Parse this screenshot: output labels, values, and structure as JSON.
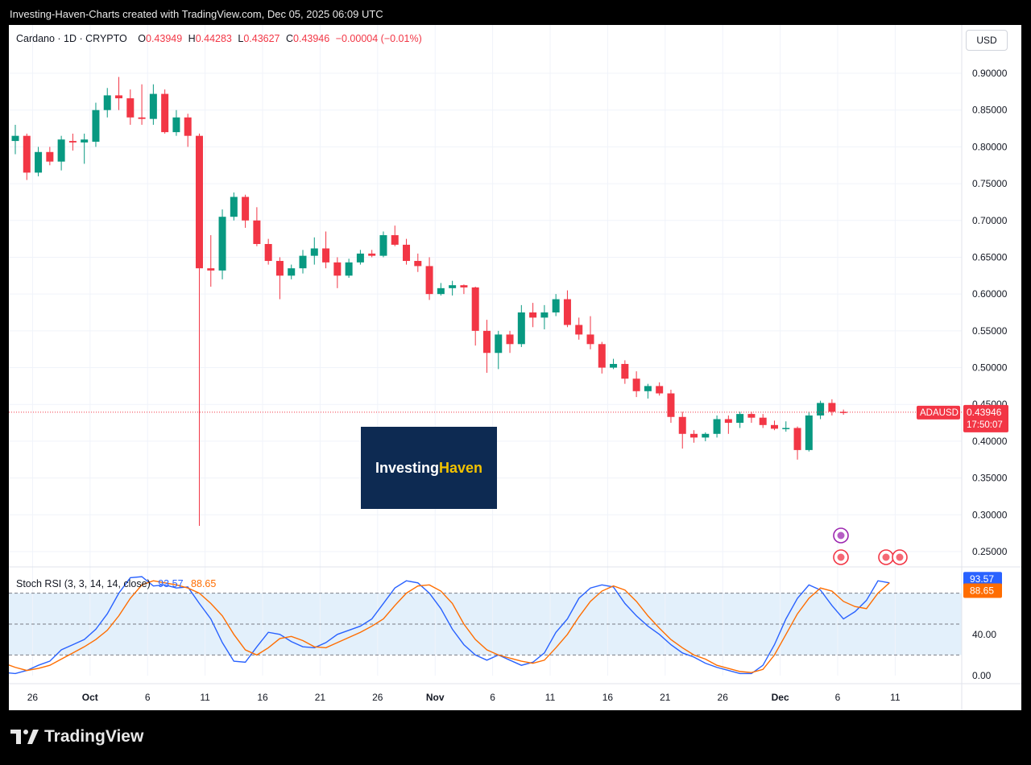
{
  "header": {
    "text": "Investing-Haven-Charts created with TradingView.com, Dec 05, 2025 06:09 UTC"
  },
  "legend": {
    "symbol": "Cardano · 1D · CRYPTO",
    "open_label": "O",
    "open": "0.43949",
    "high_label": "H",
    "high": "0.44283",
    "low_label": "L",
    "low": "0.43627",
    "close_label": "C",
    "close": "0.43946",
    "change": "−0.00004 (−0.01%)"
  },
  "currency_button": "USD",
  "price_tag": {
    "ticker": "ADAUSD",
    "price": "0.43946",
    "countdown": "17:50:07"
  },
  "logo": {
    "part1": "Investing",
    "part2": "Haven"
  },
  "brand": {
    "name": "TradingView"
  },
  "rsi_legend": {
    "label": "Stoch RSI (3, 3, 14, 14, close)",
    "k": "93.57",
    "d": "88.65"
  },
  "colors": {
    "up": "#089981",
    "down": "#f23645",
    "k_line": "#2962ff",
    "d_line": "#ff6d00",
    "logo_bg": "#0d2a52",
    "logo_accent": "#f2c200"
  },
  "chart_data": [
    {
      "type": "candlestick",
      "title": "Cardano · 1D · CRYPTO",
      "ylim": [
        0.22,
        0.95
      ],
      "y_ticks": [
        "0.90000",
        "0.85000",
        "0.80000",
        "0.75000",
        "0.70000",
        "0.65000",
        "0.60000",
        "0.55000",
        "0.50000",
        "0.45000",
        "0.40000",
        "0.35000",
        "0.30000",
        "0.25000"
      ],
      "x_ticks": [
        "26",
        "Oct",
        "6",
        "11",
        "16",
        "21",
        "26",
        "Nov",
        "6",
        "11",
        "16",
        "21",
        "26",
        "Dec",
        "6",
        "11"
      ],
      "last_price": 0.43946,
      "candles": [
        {
          "o": 0.808,
          "h": 0.83,
          "l": 0.79,
          "c": 0.815
        },
        {
          "o": 0.815,
          "h": 0.818,
          "l": 0.755,
          "c": 0.765
        },
        {
          "o": 0.765,
          "h": 0.8,
          "l": 0.76,
          "c": 0.793
        },
        {
          "o": 0.793,
          "h": 0.8,
          "l": 0.775,
          "c": 0.78
        },
        {
          "o": 0.78,
          "h": 0.815,
          "l": 0.768,
          "c": 0.81
        },
        {
          "o": 0.808,
          "h": 0.818,
          "l": 0.795,
          "c": 0.806
        },
        {
          "o": 0.806,
          "h": 0.818,
          "l": 0.777,
          "c": 0.81
        },
        {
          "o": 0.807,
          "h": 0.86,
          "l": 0.8,
          "c": 0.85
        },
        {
          "o": 0.85,
          "h": 0.88,
          "l": 0.84,
          "c": 0.87
        },
        {
          "o": 0.87,
          "h": 0.895,
          "l": 0.85,
          "c": 0.866
        },
        {
          "o": 0.866,
          "h": 0.878,
          "l": 0.83,
          "c": 0.84
        },
        {
          "o": 0.84,
          "h": 0.885,
          "l": 0.83,
          "c": 0.838
        },
        {
          "o": 0.838,
          "h": 0.885,
          "l": 0.83,
          "c": 0.872
        },
        {
          "o": 0.872,
          "h": 0.878,
          "l": 0.818,
          "c": 0.82
        },
        {
          "o": 0.82,
          "h": 0.85,
          "l": 0.815,
          "c": 0.84
        },
        {
          "o": 0.84,
          "h": 0.845,
          "l": 0.8,
          "c": 0.815
        },
        {
          "o": 0.815,
          "h": 0.818,
          "l": 0.285,
          "c": 0.635
        },
        {
          "o": 0.635,
          "h": 0.68,
          "l": 0.61,
          "c": 0.632
        },
        {
          "o": 0.632,
          "h": 0.715,
          "l": 0.62,
          "c": 0.705
        },
        {
          "o": 0.705,
          "h": 0.738,
          "l": 0.7,
          "c": 0.732
        },
        {
          "o": 0.732,
          "h": 0.735,
          "l": 0.69,
          "c": 0.7
        },
        {
          "o": 0.7,
          "h": 0.718,
          "l": 0.665,
          "c": 0.668
        },
        {
          "o": 0.668,
          "h": 0.675,
          "l": 0.64,
          "c": 0.645
        },
        {
          "o": 0.645,
          "h": 0.65,
          "l": 0.593,
          "c": 0.625
        },
        {
          "o": 0.625,
          "h": 0.64,
          "l": 0.62,
          "c": 0.635
        },
        {
          "o": 0.635,
          "h": 0.66,
          "l": 0.628,
          "c": 0.652
        },
        {
          "o": 0.652,
          "h": 0.677,
          "l": 0.64,
          "c": 0.662
        },
        {
          "o": 0.662,
          "h": 0.685,
          "l": 0.635,
          "c": 0.643
        },
        {
          "o": 0.643,
          "h": 0.65,
          "l": 0.608,
          "c": 0.625
        },
        {
          "o": 0.625,
          "h": 0.648,
          "l": 0.622,
          "c": 0.643
        },
        {
          "o": 0.643,
          "h": 0.66,
          "l": 0.64,
          "c": 0.655
        },
        {
          "o": 0.655,
          "h": 0.66,
          "l": 0.65,
          "c": 0.652
        },
        {
          "o": 0.652,
          "h": 0.685,
          "l": 0.65,
          "c": 0.68
        },
        {
          "o": 0.68,
          "h": 0.693,
          "l": 0.665,
          "c": 0.667
        },
        {
          "o": 0.667,
          "h": 0.675,
          "l": 0.64,
          "c": 0.645
        },
        {
          "o": 0.645,
          "h": 0.655,
          "l": 0.63,
          "c": 0.638
        },
        {
          "o": 0.638,
          "h": 0.65,
          "l": 0.592,
          "c": 0.6
        },
        {
          "o": 0.6,
          "h": 0.615,
          "l": 0.598,
          "c": 0.608
        },
        {
          "o": 0.608,
          "h": 0.618,
          "l": 0.598,
          "c": 0.612
        },
        {
          "o": 0.612,
          "h": 0.613,
          "l": 0.6,
          "c": 0.609
        },
        {
          "o": 0.609,
          "h": 0.61,
          "l": 0.53,
          "c": 0.55
        },
        {
          "o": 0.55,
          "h": 0.565,
          "l": 0.493,
          "c": 0.52
        },
        {
          "o": 0.52,
          "h": 0.55,
          "l": 0.498,
          "c": 0.545
        },
        {
          "o": 0.545,
          "h": 0.55,
          "l": 0.52,
          "c": 0.532
        },
        {
          "o": 0.532,
          "h": 0.585,
          "l": 0.528,
          "c": 0.575
        },
        {
          "o": 0.575,
          "h": 0.588,
          "l": 0.555,
          "c": 0.568
        },
        {
          "o": 0.568,
          "h": 0.585,
          "l": 0.552,
          "c": 0.575
        },
        {
          "o": 0.575,
          "h": 0.6,
          "l": 0.57,
          "c": 0.593
        },
        {
          "o": 0.593,
          "h": 0.605,
          "l": 0.555,
          "c": 0.558
        },
        {
          "o": 0.558,
          "h": 0.568,
          "l": 0.538,
          "c": 0.545
        },
        {
          "o": 0.545,
          "h": 0.57,
          "l": 0.525,
          "c": 0.532
        },
        {
          "o": 0.532,
          "h": 0.535,
          "l": 0.492,
          "c": 0.5
        },
        {
          "o": 0.5,
          "h": 0.512,
          "l": 0.498,
          "c": 0.505
        },
        {
          "o": 0.505,
          "h": 0.51,
          "l": 0.478,
          "c": 0.485
        },
        {
          "o": 0.485,
          "h": 0.495,
          "l": 0.46,
          "c": 0.468
        },
        {
          "o": 0.468,
          "h": 0.478,
          "l": 0.458,
          "c": 0.475
        },
        {
          "o": 0.475,
          "h": 0.48,
          "l": 0.462,
          "c": 0.465
        },
        {
          "o": 0.465,
          "h": 0.47,
          "l": 0.425,
          "c": 0.433
        },
        {
          "o": 0.433,
          "h": 0.44,
          "l": 0.39,
          "c": 0.41
        },
        {
          "o": 0.41,
          "h": 0.415,
          "l": 0.398,
          "c": 0.405
        },
        {
          "o": 0.405,
          "h": 0.412,
          "l": 0.4,
          "c": 0.41
        },
        {
          "o": 0.41,
          "h": 0.435,
          "l": 0.405,
          "c": 0.43
        },
        {
          "o": 0.43,
          "h": 0.435,
          "l": 0.41,
          "c": 0.425
        },
        {
          "o": 0.425,
          "h": 0.44,
          "l": 0.418,
          "c": 0.437
        },
        {
          "o": 0.437,
          "h": 0.44,
          "l": 0.425,
          "c": 0.432
        },
        {
          "o": 0.432,
          "h": 0.437,
          "l": 0.418,
          "c": 0.422
        },
        {
          "o": 0.422,
          "h": 0.428,
          "l": 0.415,
          "c": 0.417
        },
        {
          "o": 0.417,
          "h": 0.427,
          "l": 0.413,
          "c": 0.418
        },
        {
          "o": 0.418,
          "h": 0.42,
          "l": 0.375,
          "c": 0.388
        },
        {
          "o": 0.388,
          "h": 0.44,
          "l": 0.386,
          "c": 0.435
        },
        {
          "o": 0.435,
          "h": 0.455,
          "l": 0.43,
          "c": 0.452
        },
        {
          "o": 0.452,
          "h": 0.457,
          "l": 0.435,
          "c": 0.44
        },
        {
          "o": 0.44,
          "h": 0.443,
          "l": 0.436,
          "c": 0.4395
        }
      ]
    },
    {
      "type": "line",
      "title": "Stoch RSI (3, 3, 14, 14, close)",
      "ylim": [
        0,
        100
      ],
      "y_ticks": [
        "0.00",
        "40.00"
      ],
      "bands": [
        20,
        50,
        80
      ],
      "series": [
        {
          "name": "K",
          "values": [
            3,
            2,
            5,
            10,
            14,
            25,
            30,
            35,
            45,
            60,
            80,
            95,
            96,
            87,
            88,
            85,
            86,
            70,
            55,
            32,
            14,
            13,
            28,
            42,
            40,
            33,
            28,
            27,
            32,
            40,
            44,
            48,
            55,
            70,
            85,
            92,
            90,
            80,
            65,
            45,
            30,
            20,
            15,
            20,
            15,
            10,
            13,
            22,
            42,
            55,
            75,
            85,
            88,
            86,
            70,
            58,
            48,
            40,
            30,
            22,
            18,
            12,
            8,
            5,
            2,
            2,
            10,
            30,
            55,
            75,
            88,
            83,
            68,
            55,
            62,
            73,
            92,
            90
          ]
        },
        {
          "name": "D",
          "values": [
            12,
            8,
            5,
            7,
            10,
            16,
            22,
            28,
            35,
            44,
            58,
            75,
            88,
            92,
            90,
            88,
            85,
            80,
            70,
            58,
            40,
            25,
            20,
            27,
            36,
            38,
            34,
            28,
            27,
            32,
            37,
            42,
            48,
            55,
            68,
            80,
            87,
            88,
            82,
            70,
            50,
            35,
            25,
            20,
            17,
            14,
            12,
            15,
            27,
            40,
            57,
            72,
            82,
            87,
            83,
            72,
            58,
            46,
            35,
            27,
            20,
            16,
            10,
            7,
            4,
            3,
            6,
            20,
            40,
            60,
            75,
            85,
            82,
            72,
            67,
            65,
            80,
            90
          ]
        }
      ]
    }
  ]
}
